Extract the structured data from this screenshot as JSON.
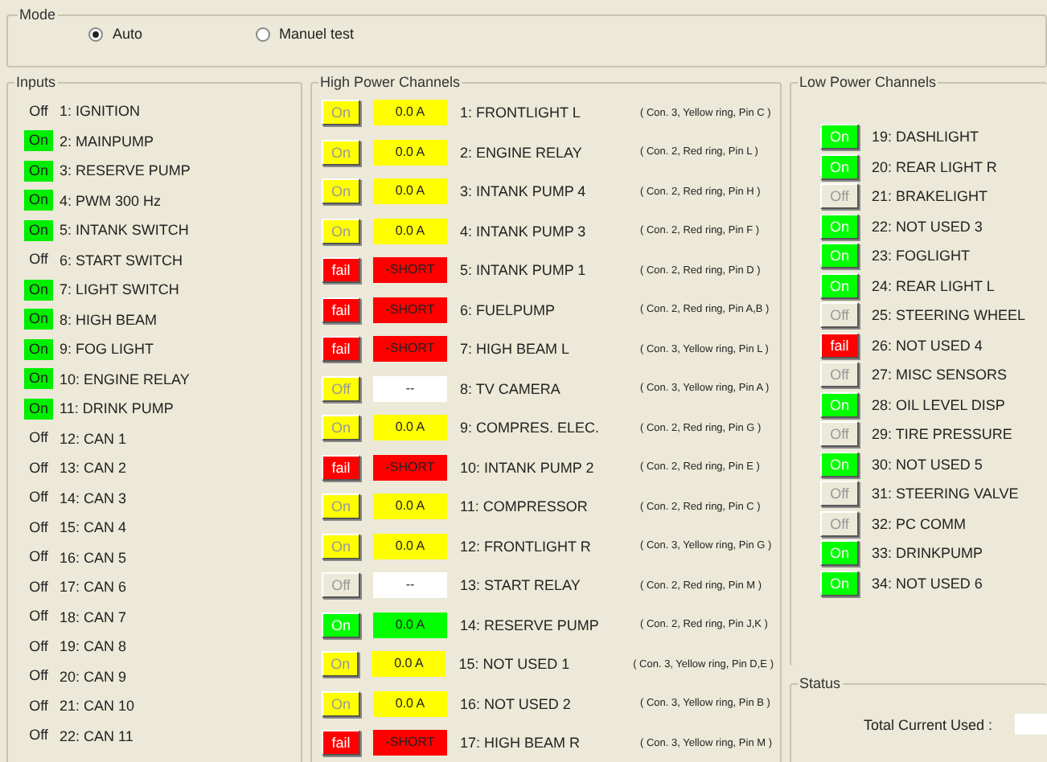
{
  "mode": {
    "title": "Mode",
    "options": [
      {
        "label": "Auto",
        "selected": true
      },
      {
        "label": "Manuel test",
        "selected": false
      }
    ]
  },
  "inputs": {
    "title": "Inputs",
    "items": [
      {
        "status": "Off",
        "on": false,
        "label": "1: IGNITION"
      },
      {
        "status": "On",
        "on": true,
        "label": "2: MAINPUMP"
      },
      {
        "status": "On",
        "on": true,
        "label": "3: RESERVE PUMP"
      },
      {
        "status": "On",
        "on": true,
        "label": "4: PWM 300 Hz"
      },
      {
        "status": "On",
        "on": true,
        "label": "5: INTANK SWITCH"
      },
      {
        "status": "Off",
        "on": false,
        "label": "6: START SWITCH"
      },
      {
        "status": "On",
        "on": true,
        "label": "7: LIGHT SWITCH"
      },
      {
        "status": "On",
        "on": true,
        "label": "8: HIGH BEAM"
      },
      {
        "status": "On",
        "on": true,
        "label": "9: FOG LIGHT"
      },
      {
        "status": "On",
        "on": true,
        "label": "10: ENGINE RELAY"
      },
      {
        "status": "On",
        "on": true,
        "label": "11: DRINK PUMP"
      },
      {
        "status": "Off",
        "on": false,
        "label": "12: CAN 1"
      },
      {
        "status": "Off",
        "on": false,
        "label": "13: CAN 2"
      },
      {
        "status": "Off",
        "on": false,
        "label": "14: CAN 3"
      },
      {
        "status": "Off",
        "on": false,
        "label": "15: CAN 4"
      },
      {
        "status": "Off",
        "on": false,
        "label": "16: CAN 5"
      },
      {
        "status": "Off",
        "on": false,
        "label": "17: CAN 6"
      },
      {
        "status": "Off",
        "on": false,
        "label": "18: CAN 7"
      },
      {
        "status": "Off",
        "on": false,
        "label": "19: CAN 8"
      },
      {
        "status": "Off",
        "on": false,
        "label": "20: CAN 9"
      },
      {
        "status": "Off",
        "on": false,
        "label": "21: CAN 10"
      },
      {
        "status": "Off",
        "on": false,
        "label": "22: CAN 11"
      }
    ]
  },
  "high_power": {
    "title": "High Power Channels",
    "channels": [
      {
        "button": "On",
        "color": "#ffff00",
        "reading": {
          "text": "0.0 A",
          "color": "#ffff00"
        },
        "label": "1: FRONTLIGHT L",
        "pin": "( Con. 3, Yellow ring, Pin C )"
      },
      {
        "button": "On",
        "color": "#ffff00",
        "reading": {
          "text": "0.0 A",
          "color": "#ffff00"
        },
        "label": "2: ENGINE RELAY",
        "pin": "( Con. 2, Red ring, Pin L )"
      },
      {
        "button": "On",
        "color": "#ffff00",
        "reading": {
          "text": "0.0 A",
          "color": "#ffff00"
        },
        "label": "3: INTANK PUMP 4",
        "pin": "( Con. 2, Red ring, Pin H )"
      },
      {
        "button": "On",
        "color": "#ffff00",
        "reading": {
          "text": "0.0 A",
          "color": "#ffff00"
        },
        "label": "4: INTANK PUMP 3",
        "pin": "( Con. 2, Red ring, Pin F )"
      },
      {
        "button": "fail",
        "color": "#ff0000",
        "reading": {
          "text": "-SHORT",
          "color": "#ff0000"
        },
        "label": "5: INTANK PUMP 1",
        "pin": "( Con. 2, Red ring, Pin D )"
      },
      {
        "button": "fail",
        "color": "#ff0000",
        "reading": {
          "text": "-SHORT",
          "color": "#ff0000"
        },
        "label": "6: FUELPUMP",
        "pin": "( Con. 2, Red ring, Pin A,B )"
      },
      {
        "button": "fail",
        "color": "#ff0000",
        "reading": {
          "text": "-SHORT",
          "color": "#ff0000"
        },
        "label": "7: HIGH BEAM L",
        "pin": "( Con. 3, Yellow ring, Pin L )"
      },
      {
        "button": "Off",
        "color": "#ffff00",
        "reading": {
          "text": "--",
          "color": "#ffffff"
        },
        "label": "8: TV CAMERA",
        "pin": "( Con. 3, Yellow ring, Pin A )"
      },
      {
        "button": "On",
        "color": "#ffff00",
        "reading": {
          "text": "0.0 A",
          "color": "#ffff00"
        },
        "label": "9: COMPRES. ELEC.",
        "pin": "( Con. 2, Red ring, Pin G )"
      },
      {
        "button": "fail",
        "color": "#ff0000",
        "reading": {
          "text": "-SHORT",
          "color": "#ff0000"
        },
        "label": "10: INTANK PUMP 2",
        "pin": "( Con. 2, Red ring, Pin E )"
      },
      {
        "button": "On",
        "color": "#ffff00",
        "reading": {
          "text": "0.0 A",
          "color": "#ffff00"
        },
        "label": "11: COMPRESSOR",
        "pin": "( Con. 2, Red ring, Pin C )"
      },
      {
        "button": "On",
        "color": "#ffff00",
        "reading": {
          "text": "0.0 A",
          "color": "#ffff00"
        },
        "label": "12: FRONTLIGHT R",
        "pin": "( Con. 3, Yellow ring, Pin G )"
      },
      {
        "button": "Off",
        "color": "#ece9d8",
        "reading": {
          "text": "--",
          "color": "#ffffff"
        },
        "label": "13: START RELAY",
        "pin": "( Con. 2, Red ring, Pin M )"
      },
      {
        "button": "On",
        "color": "#00ff00",
        "reading": {
          "text": "0.0 A",
          "color": "#00ff00"
        },
        "label": "14: RESERVE PUMP",
        "pin": "( Con. 2, Red ring, Pin J,K )"
      },
      {
        "button": "On",
        "color": "#ffff00",
        "reading": {
          "text": "0.0 A",
          "color": "#ffff00"
        },
        "label": "15: NOT USED 1",
        "pin": "( Con. 3, Yellow ring, Pin D,E )"
      },
      {
        "button": "On",
        "color": "#ffff00",
        "reading": {
          "text": "0.0 A",
          "color": "#ffff00"
        },
        "label": "16: NOT USED 2",
        "pin": "( Con. 3, Yellow ring, Pin B )"
      },
      {
        "button": "fail",
        "color": "#ff0000",
        "reading": {
          "text": "-SHORT",
          "color": "#ff0000"
        },
        "label": "17: HIGH BEAM R",
        "pin": "( Con. 3, Yellow ring, Pin M )"
      }
    ]
  },
  "low_power": {
    "title": "Low Power Channels",
    "channels": [
      {
        "button": "On",
        "color": "#00ff00",
        "label": "19: DASHLIGHT"
      },
      {
        "button": "On",
        "color": "#00ff00",
        "label": "20: REAR LIGHT R"
      },
      {
        "button": "Off",
        "color": "#ece9d8",
        "label": "21: BRAKELIGHT"
      },
      {
        "button": "On",
        "color": "#00ff00",
        "label": "22: NOT USED 3"
      },
      {
        "button": "On",
        "color": "#00ff00",
        "label": "23: FOGLIGHT"
      },
      {
        "button": "On",
        "color": "#00ff00",
        "label": "24: REAR LIGHT L"
      },
      {
        "button": "Off",
        "color": "#ece9d8",
        "label": "25: STEERING WHEEL"
      },
      {
        "button": "fail",
        "color": "#ff0000",
        "label": "26: NOT USED 4"
      },
      {
        "button": "Off",
        "color": "#ece9d8",
        "label": "27: MISC SENSORS"
      },
      {
        "button": "On",
        "color": "#00ff00",
        "label": "28: OIL LEVEL DISP"
      },
      {
        "button": "Off",
        "color": "#ece9d8",
        "label": "29: TIRE PRESSURE"
      },
      {
        "button": "On",
        "color": "#00ff00",
        "label": "30: NOT USED 5"
      },
      {
        "button": "Off",
        "color": "#ece9d8",
        "label": "31: STEERING VALVE"
      },
      {
        "button": "Off",
        "color": "#ece9d8",
        "label": "32: PC COMM"
      },
      {
        "button": "On",
        "color": "#00ff00",
        "label": "33: DRINKPUMP"
      },
      {
        "button": "On",
        "color": "#00ff00",
        "label": "34: NOT USED 6"
      }
    ]
  },
  "status": {
    "title": "Status",
    "total_label": "Total Current Used :"
  }
}
